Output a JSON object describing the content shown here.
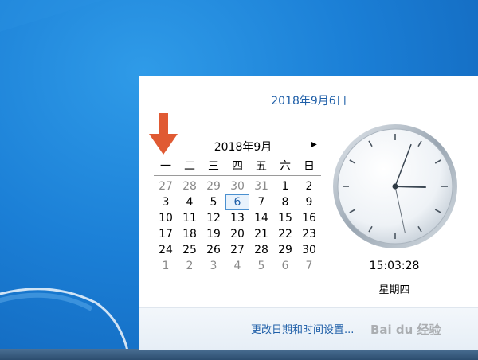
{
  "calendar_popup": {
    "date_header": "2018年9月6日",
    "month_title": "2018年9月",
    "next_month_icon": "triangle-right",
    "weekdays": [
      "一",
      "二",
      "三",
      "四",
      "五",
      "六",
      "日"
    ],
    "weeks": [
      [
        "27",
        "28",
        "29",
        "30",
        "31",
        "1",
        "2"
      ],
      [
        "3",
        "4",
        "5",
        "6",
        "7",
        "8",
        "9"
      ],
      [
        "10",
        "11",
        "12",
        "13",
        "14",
        "15",
        "16"
      ],
      [
        "17",
        "18",
        "19",
        "20",
        "21",
        "22",
        "23"
      ],
      [
        "24",
        "25",
        "26",
        "27",
        "28",
        "29",
        "30"
      ],
      [
        "1",
        "2",
        "3",
        "4",
        "5",
        "6",
        "7"
      ]
    ],
    "other_month_cells": [
      [
        0,
        0
      ],
      [
        0,
        1
      ],
      [
        0,
        2
      ],
      [
        0,
        3
      ],
      [
        0,
        4
      ],
      [
        5,
        0
      ],
      [
        5,
        1
      ],
      [
        5,
        2
      ],
      [
        5,
        3
      ],
      [
        5,
        4
      ],
      [
        5,
        5
      ],
      [
        5,
        6
      ]
    ],
    "selected_cell": [
      1,
      3
    ],
    "time": "15:03:28",
    "weekday_name": "星期四",
    "settings_link": "更改日期和时间设置...",
    "watermark": "Bai du 经验"
  },
  "clock": {
    "hour": 15,
    "minute": 3,
    "second": 28
  },
  "colors": {
    "accent": "#1f5fa8",
    "arrow": "#e05a33",
    "desktop": "#1b7fd6"
  }
}
